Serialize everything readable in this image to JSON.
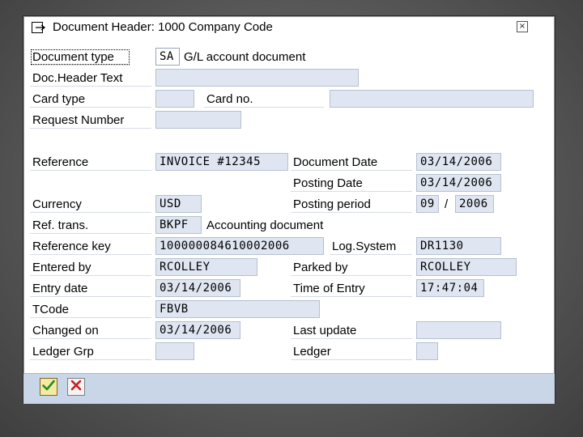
{
  "window": {
    "title": "Document Header: 1000 Company Code",
    "close_glyph": "×"
  },
  "form": {
    "document_type": {
      "label": "Document type",
      "value": "SA",
      "description": "G/L account document"
    },
    "doc_header_text": {
      "label": "Doc.Header Text",
      "value": ""
    },
    "card_type": {
      "label": "Card type",
      "value": ""
    },
    "card_no": {
      "label": "Card no.",
      "value": ""
    },
    "request_number": {
      "label": "Request Number",
      "value": ""
    },
    "reference": {
      "label": "Reference",
      "value": "INVOICE #12345"
    },
    "document_date": {
      "label": "Document Date",
      "value": "03/14/2006"
    },
    "posting_date": {
      "label": "Posting Date",
      "value": "03/14/2006"
    },
    "currency": {
      "label": "Currency",
      "value": "USD"
    },
    "posting_period": {
      "label": "Posting period",
      "period": "09",
      "separator": "/",
      "year": "2006"
    },
    "ref_trans": {
      "label": "Ref. trans.",
      "value": "BKPF",
      "description": "Accounting document"
    },
    "reference_key": {
      "label": "Reference key",
      "value": "100000084610002006"
    },
    "log_system": {
      "label": "Log.System",
      "value": "DR1130"
    },
    "entered_by": {
      "label": "Entered by",
      "value": "RCOLLEY"
    },
    "parked_by": {
      "label": "Parked by",
      "value": "RCOLLEY"
    },
    "entry_date": {
      "label": "Entry date",
      "value": "03/14/2006"
    },
    "time_of_entry": {
      "label": "Time of Entry",
      "value": "17:47:04"
    },
    "tcode": {
      "label": "TCode",
      "value": "FBVB"
    },
    "changed_on": {
      "label": "Changed on",
      "value": "03/14/2006"
    },
    "last_update": {
      "label": "Last update",
      "value": ""
    },
    "ledger_grp": {
      "label": "Ledger Grp",
      "value": ""
    },
    "ledger": {
      "label": "Ledger",
      "value": ""
    }
  },
  "footer": {
    "confirm_icon": "checkmark-icon",
    "cancel_icon": "cancel-x-icon"
  },
  "colors": {
    "field_bg": "#dfe6f1",
    "footer_bg": "#c9d6e8",
    "confirm_check": "#1f8f1f",
    "cancel_x": "#c81e1e"
  }
}
